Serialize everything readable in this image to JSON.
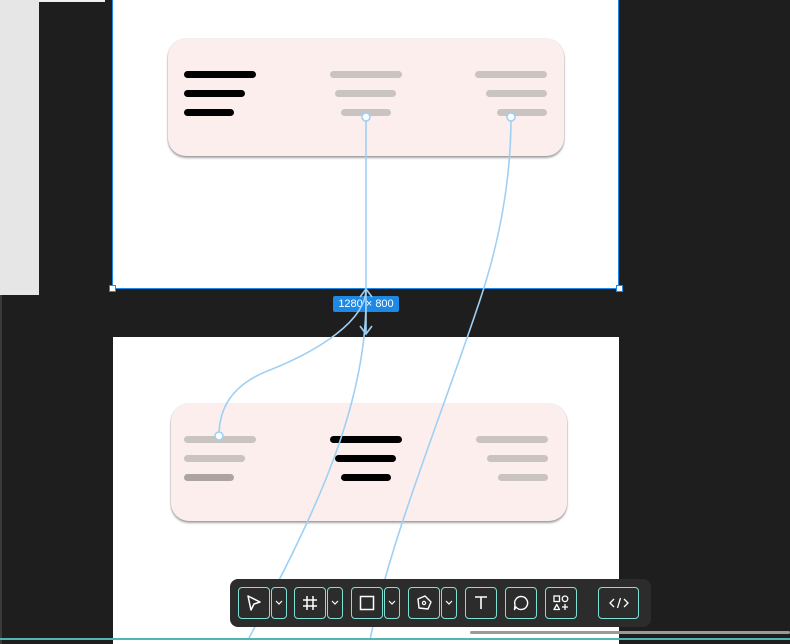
{
  "canvas": {
    "size_label": "1280 × 800"
  },
  "toolbar": {
    "tools": [
      {
        "name": "move-tool",
        "icon": "pointer-arrow-icon"
      },
      {
        "name": "frame-tool",
        "icon": "frame-hash-icon"
      },
      {
        "name": "shape-tool",
        "icon": "rectangle-icon"
      },
      {
        "name": "pen-tool",
        "icon": "pen-nib-icon"
      },
      {
        "name": "text-tool",
        "icon": "text-t-icon"
      },
      {
        "name": "comment-tool",
        "icon": "speech-bubble-icon"
      },
      {
        "name": "assets-tool",
        "icon": "shapes-plus-icon"
      },
      {
        "name": "code-tool",
        "icon": "code-brackets-icon"
      }
    ]
  },
  "colors": {
    "selection": "#1e88e5",
    "wire": "#9fd0f4",
    "card": "#fceeed",
    "toolbar_accent": "#7fe0d4"
  }
}
